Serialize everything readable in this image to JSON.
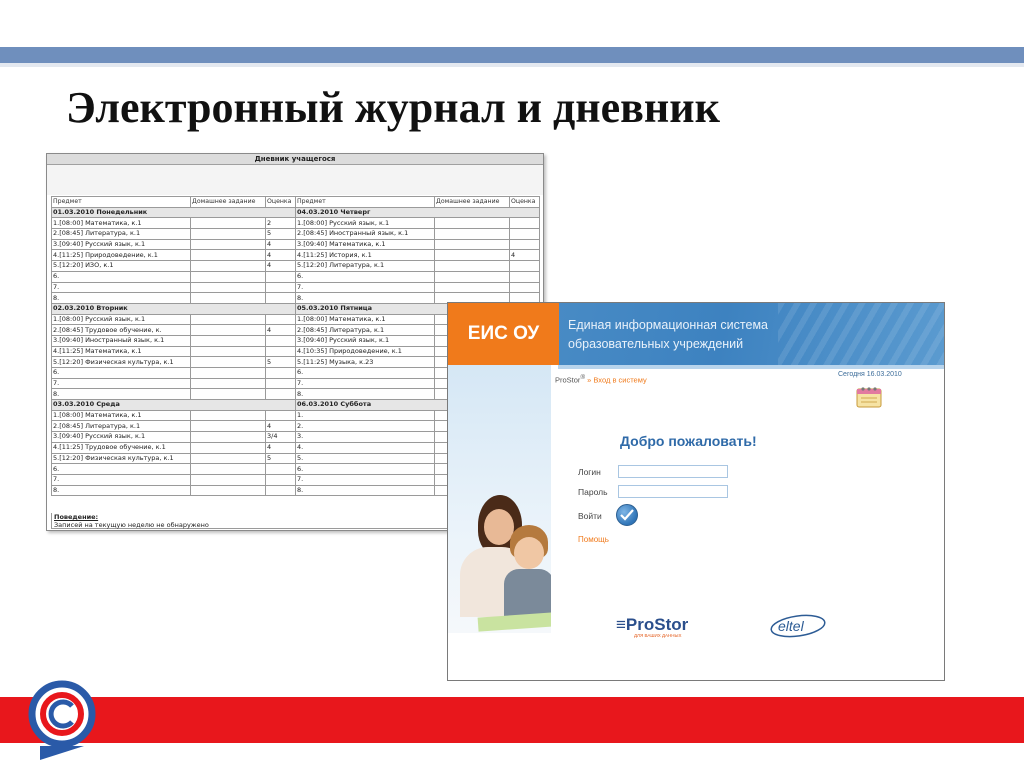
{
  "slide": {
    "title": "Электронный журнал и дневник"
  },
  "diary": {
    "title": "Дневник учащегося",
    "headers": {
      "subject": "Предмет",
      "homework": "Домашнее задание",
      "grade": "Оценка"
    },
    "left": [
      {
        "day": "01.03.2010 Понедельник",
        "rows": [
          [
            "1.[08:00] Математика, к.1",
            "",
            "2"
          ],
          [
            "2.[08:45] Литература, к.1",
            "",
            "5"
          ],
          [
            "3.[09:40] Русский язык, к.1",
            "",
            "4"
          ],
          [
            "4.[11:25] Природоведение, к.1",
            "",
            "4"
          ],
          [
            "5.[12:20] ИЗО, к.1",
            "",
            "4"
          ],
          [
            "6.",
            "",
            ""
          ],
          [
            "7.",
            "",
            ""
          ],
          [
            "8.",
            "",
            ""
          ]
        ]
      },
      {
        "day": "02.03.2010 Вторник",
        "rows": [
          [
            "1.[08:00] Русский язык, к.1",
            "",
            ""
          ],
          [
            "2.[08:45] Трудовое обучение, к.",
            "",
            "4"
          ],
          [
            "3.[09:40] Иностранный язык, к.1",
            "",
            ""
          ],
          [
            "4.[11:25] Математика, к.1",
            "",
            ""
          ],
          [
            "5.[12:20] Физическая культура, к.1",
            "",
            "5"
          ],
          [
            "6.",
            "",
            ""
          ],
          [
            "7.",
            "",
            ""
          ],
          [
            "8.",
            "",
            ""
          ]
        ]
      },
      {
        "day": "03.03.2010 Среда",
        "rows": [
          [
            "1.[08:00] Математика, к.1",
            "",
            ""
          ],
          [
            "2.[08:45] Литература, к.1",
            "",
            "4"
          ],
          [
            "3.[09:40] Русский язык, к.1",
            "",
            "3/4"
          ],
          [
            "4.[11:25] Трудовое обучение, к.1",
            "",
            "4"
          ],
          [
            "5.[12:20] Физическая культура, к.1",
            "",
            "5"
          ],
          [
            "6.",
            "",
            ""
          ],
          [
            "7.",
            "",
            ""
          ],
          [
            "8.",
            "",
            ""
          ]
        ]
      }
    ],
    "right": [
      {
        "day": "04.03.2010 Четверг",
        "rows": [
          [
            "1.[08:00] Русский язык, к.1",
            "",
            ""
          ],
          [
            "2.[08:45] Иностранный язык, к.1",
            "",
            ""
          ],
          [
            "3.[09:40] Математика, к.1",
            "",
            ""
          ],
          [
            "4.[11:25] История, к.1",
            "",
            "4"
          ],
          [
            "5.[12:20] Литература, к.1",
            "",
            ""
          ],
          [
            "6.",
            "",
            ""
          ],
          [
            "7.",
            "",
            ""
          ],
          [
            "8.",
            "",
            ""
          ]
        ]
      },
      {
        "day": "05.03.2010 Пятница",
        "rows": [
          [
            "1.[08:00] Математика, к.1",
            "",
            ""
          ],
          [
            "2.[08:45] Литература, к.1",
            "",
            ""
          ],
          [
            "3.[09:40] Русский язык, к.1",
            "",
            ""
          ],
          [
            "4.[10:35] Природоведение, к.1",
            "",
            ""
          ],
          [
            "5.[11:25] Музыка, к.23",
            "",
            ""
          ],
          [
            "6.",
            "",
            ""
          ],
          [
            "7.",
            "",
            ""
          ],
          [
            "8.",
            "",
            ""
          ]
        ]
      },
      {
        "day": "06.03.2010 Суббота",
        "rows": [
          [
            "1.",
            "",
            ""
          ],
          [
            "2.",
            "",
            ""
          ],
          [
            "3.",
            "",
            ""
          ],
          [
            "4.",
            "",
            ""
          ],
          [
            "5.",
            "",
            ""
          ],
          [
            "6.",
            "",
            ""
          ],
          [
            "7.",
            "",
            ""
          ],
          [
            "8.",
            "",
            ""
          ]
        ]
      }
    ],
    "behavior_label": "Поведение:",
    "behavior_text": "Записей на текущую неделю не обнаружено"
  },
  "login": {
    "logo": "ЕИС ОУ",
    "subtitle_line1": "Единая информационная система",
    "subtitle_line2": "образовательных учреждений",
    "breadcrumb_home": "ProStor",
    "breadcrumb_sup": "®",
    "breadcrumb_sep": " » ",
    "breadcrumb_link": "Вход в систему",
    "today": "Сегодня 16.03.2010",
    "welcome": "Добро пожаловать!",
    "login_label": "Логин",
    "password_label": "Пароль",
    "login_value": "",
    "password_value": "",
    "submit_label": "Войти",
    "help": "Помощь",
    "brand1": "ProStor",
    "brand1_sub": "ДЛЯ ВАШИХ ДАННЫХ",
    "brand2": "eltel"
  },
  "colors": {
    "accent_orange": "#f07a1b",
    "header_blue": "#3d82c0",
    "bar_red": "#e8171c",
    "bar_blue": "#6f8fbd"
  }
}
